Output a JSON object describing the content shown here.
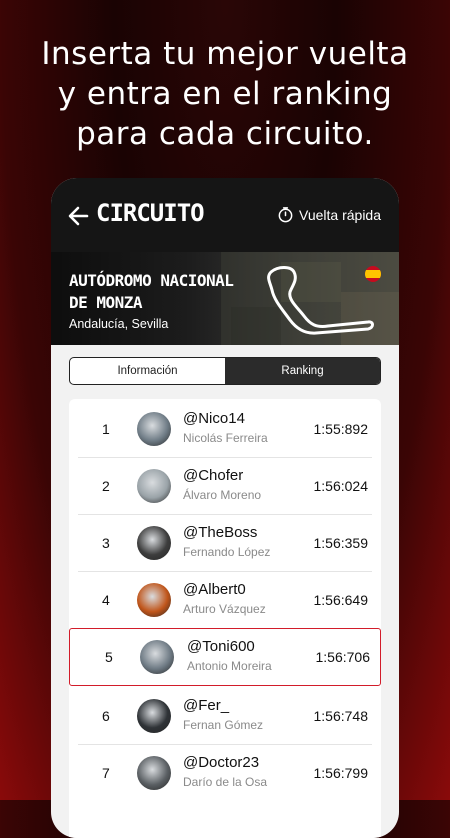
{
  "promo": {
    "line1": "Inserta tu mejor vuelta",
    "line2": "y entra en el ranking",
    "line3": "para cada circuito."
  },
  "appbar": {
    "title": "CIRCUITO",
    "fast_lap_label": "Vuelta rápida",
    "back_icon": "arrow-left-icon",
    "stopwatch_icon": "stopwatch-icon"
  },
  "circuit": {
    "name": "AUTÓDROMO NACIONAL DE MONZA",
    "region": "Andalucía, Sevilla",
    "flag": "spain-flag-icon"
  },
  "tabs": [
    {
      "label": "Información",
      "active": false
    },
    {
      "label": "Ranking",
      "active": true
    }
  ],
  "ranking": [
    {
      "pos": "1",
      "user": "@Nico14",
      "name": "Nicolás Ferreira",
      "time": "1:55:892",
      "avatar_color": "#6f7c86"
    },
    {
      "pos": "2",
      "user": "@Chofer",
      "name": "Álvaro Moreno",
      "time": "1:56:024",
      "avatar_color": "#9aa3a8"
    },
    {
      "pos": "3",
      "user": "@TheBoss",
      "name": "Fernando López",
      "time": "1:56:359",
      "avatar_color": "#3d3d3d"
    },
    {
      "pos": "4",
      "user": "@Albert0",
      "name": "Arturo Vázquez",
      "time": "1:56:649",
      "avatar_color": "#c0551a"
    },
    {
      "pos": "5",
      "user": "@Toni600",
      "name": "Antonio Moreira",
      "time": "1:56:706",
      "avatar_color": "#6e7a84",
      "highlight": true
    },
    {
      "pos": "6",
      "user": "@Fer_",
      "name": "Fernan Gómez",
      "time": "1:56:748",
      "avatar_color": "#2f3337"
    },
    {
      "pos": "7",
      "user": "@Doctor23",
      "name": "Darío de la Osa",
      "time": "1:56:799",
      "avatar_color": "#5a5f63"
    }
  ],
  "colors": {
    "highlight_border": "#d21c2a",
    "appbar": "#151515"
  }
}
